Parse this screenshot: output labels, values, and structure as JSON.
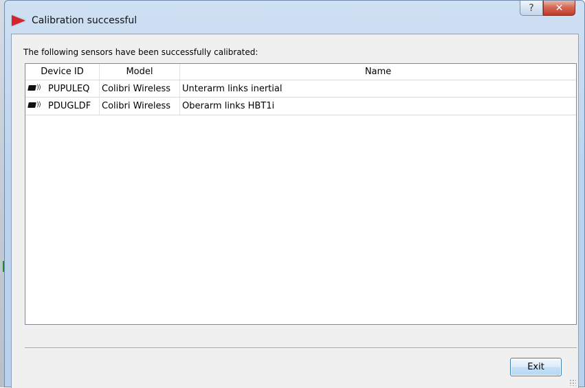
{
  "window": {
    "title": "Calibration successful",
    "help_glyph": "?",
    "close_glyph": "✕"
  },
  "dialog": {
    "message": "The following sensors have been successfully calibrated:",
    "columns": [
      "Device ID",
      "Model",
      "Name"
    ],
    "rows": [
      {
        "device_id": "PUPULEQ",
        "model": "Colibri Wireless",
        "name": "Unterarm links inertial",
        "icon": "wireless-sensor-icon"
      },
      {
        "device_id": "PDUGLDF",
        "model": "Colibri Wireless",
        "name": "Oberarm links HBT1i",
        "icon": "wireless-sensor-icon"
      }
    ],
    "exit_label": "Exit"
  },
  "icons": {
    "app": "play-triangle-icon",
    "sensor": "wireless-sensor-icon"
  },
  "colors": {
    "app_icon_red": "#d4232b",
    "close_button": "#c0392b",
    "button_border": "#3c7fb1",
    "frame_blue": "#bcd3ee"
  }
}
